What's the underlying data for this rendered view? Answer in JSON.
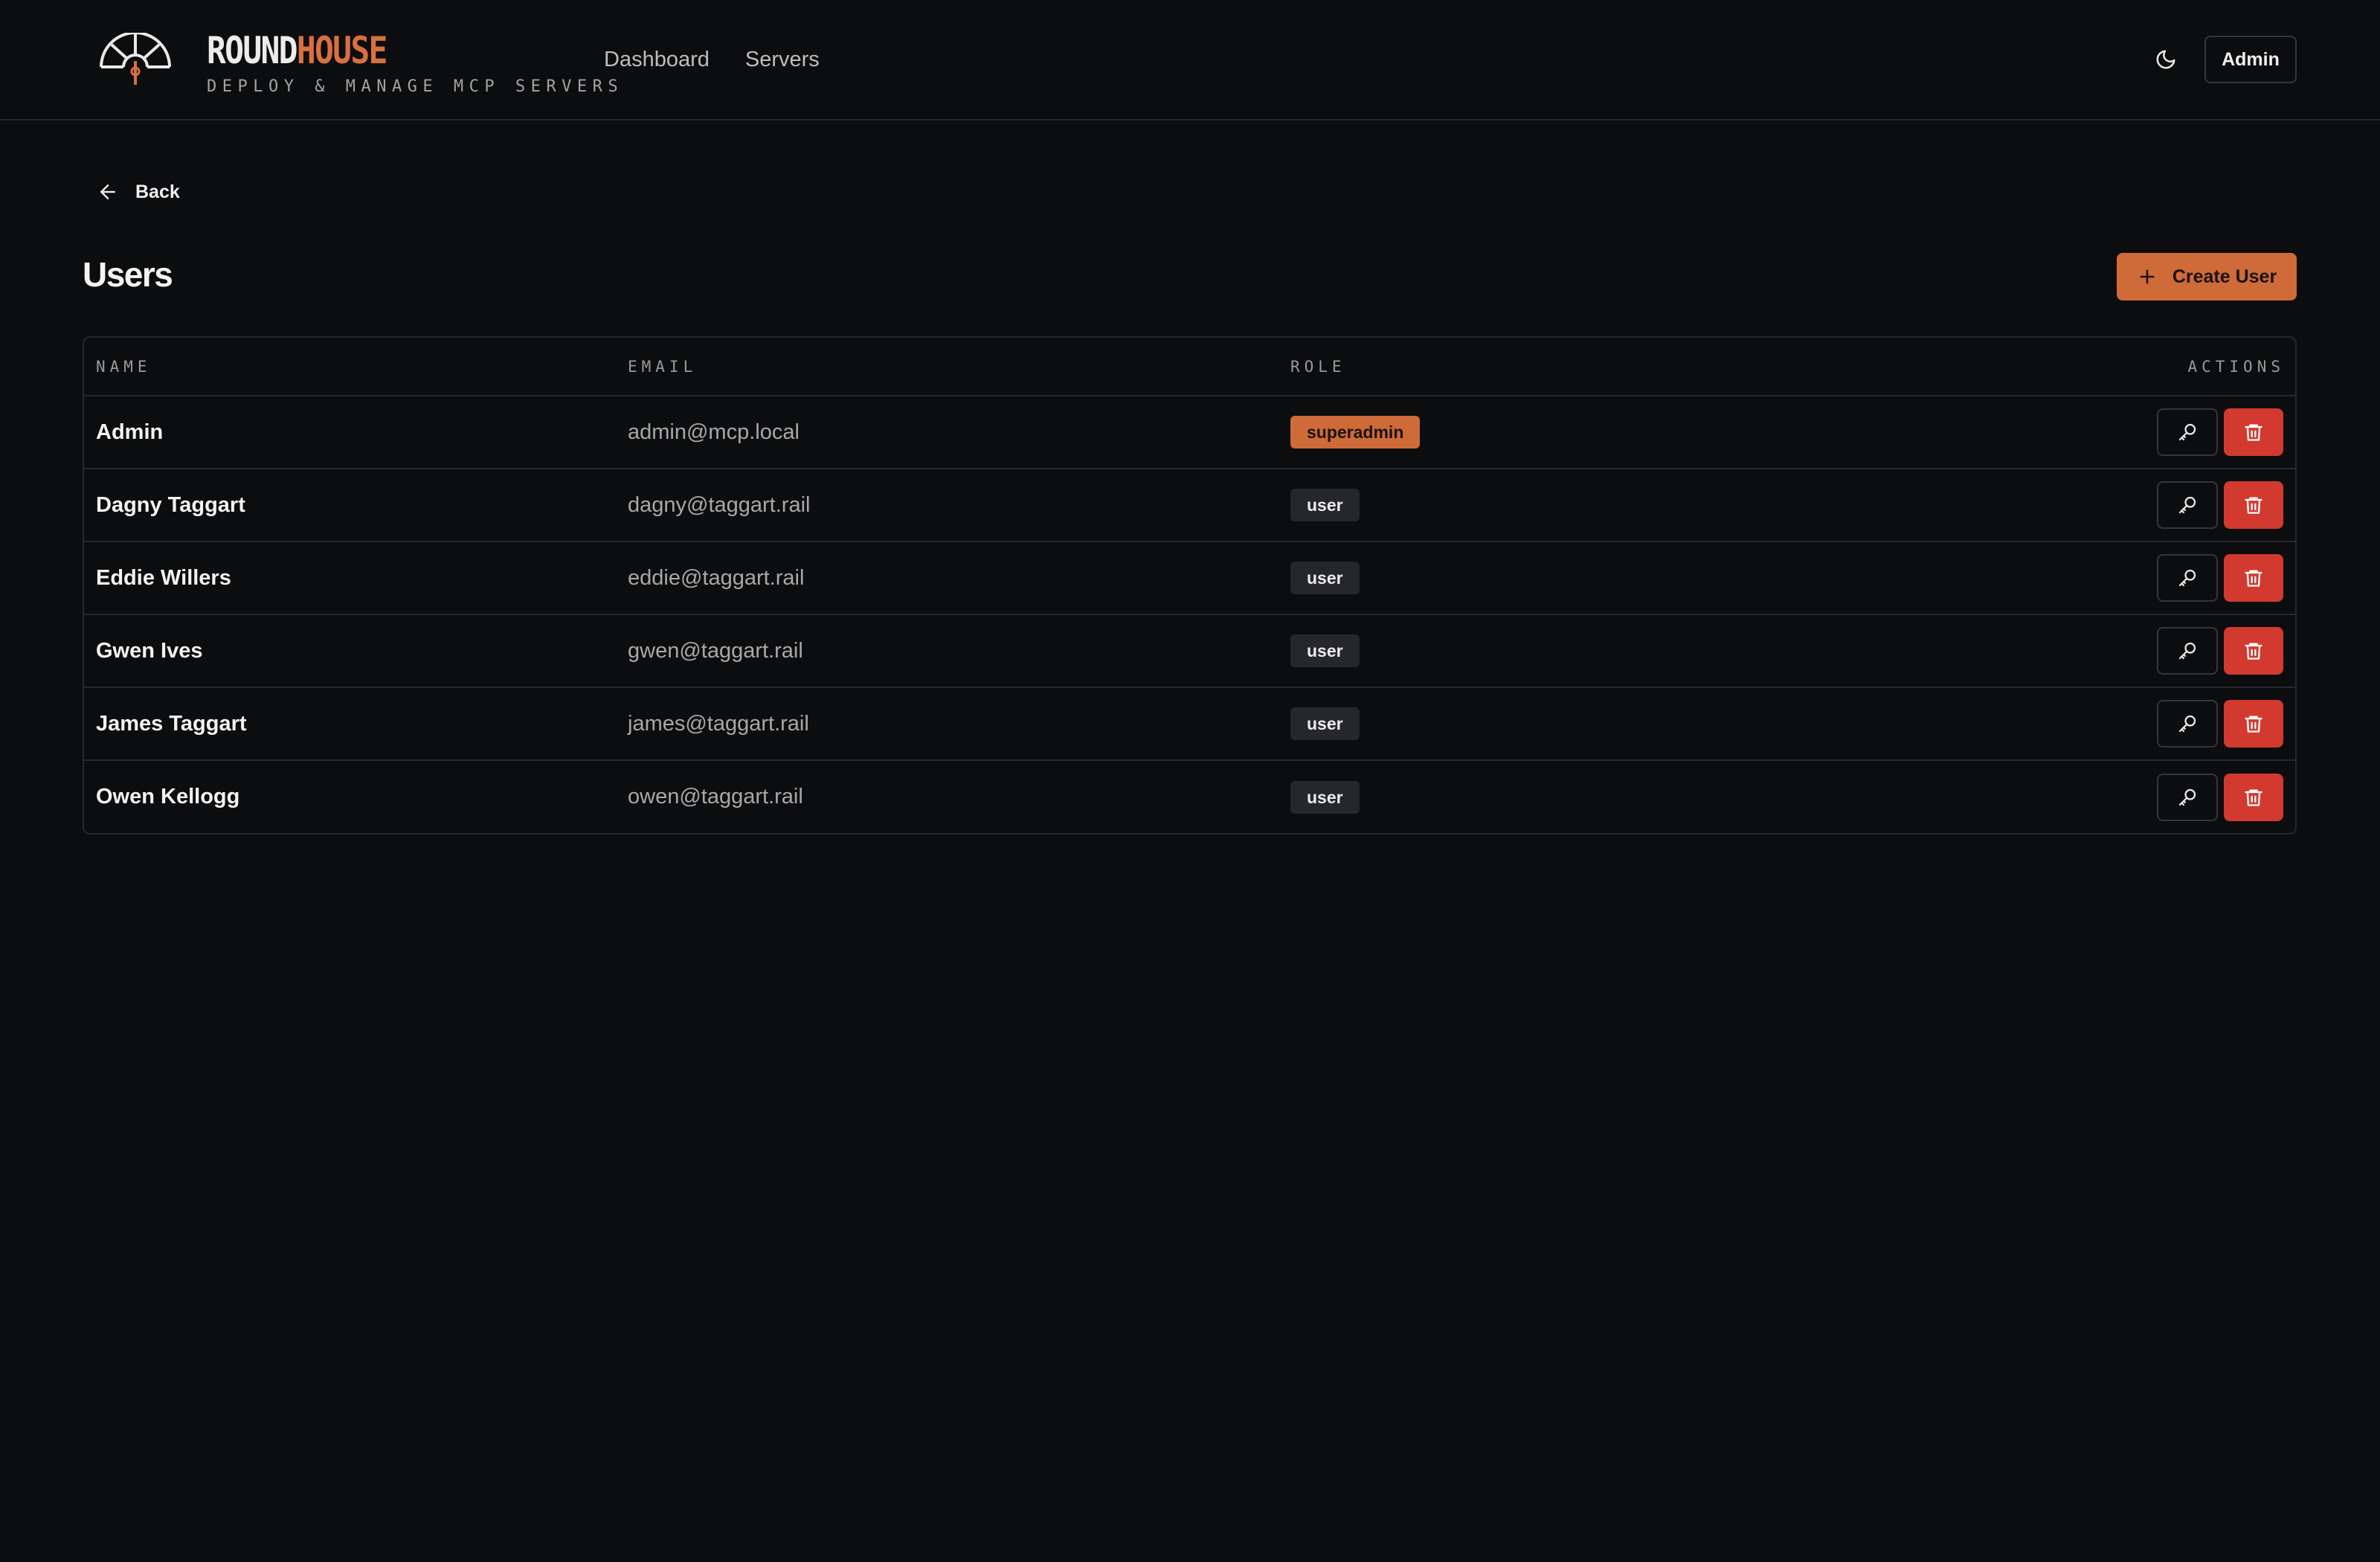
{
  "header": {
    "brand_word1": "ROUND",
    "brand_word2": "HOUSE",
    "tagline": "DEPLOY & MANAGE MCP SERVERS",
    "nav": [
      "Dashboard",
      "Servers"
    ],
    "theme_icon": "moon-icon",
    "user_button": "Admin"
  },
  "page": {
    "back_label": "Back",
    "title": "Users",
    "create_button": "Create User"
  },
  "table": {
    "columns": [
      "NAME",
      "EMAIL",
      "ROLE",
      "ACTIONS"
    ],
    "rows": [
      {
        "name": "Admin",
        "email": "admin@mcp.local",
        "role": "superadmin"
      },
      {
        "name": "Dagny Taggart",
        "email": "dagny@taggart.rail",
        "role": "user"
      },
      {
        "name": "Eddie Willers",
        "email": "eddie@taggart.rail",
        "role": "user"
      },
      {
        "name": "Gwen Ives",
        "email": "gwen@taggart.rail",
        "role": "user"
      },
      {
        "name": "James Taggart",
        "email": "james@taggart.rail",
        "role": "user"
      },
      {
        "name": "Owen Kellogg",
        "email": "owen@taggart.rail",
        "role": "user"
      }
    ],
    "row_actions": [
      "key-icon",
      "trash-icon"
    ]
  },
  "colors": {
    "background": "#0c0d0f",
    "accent": "#cf6a39",
    "danger": "#d23a2f",
    "border": "#26282c"
  }
}
